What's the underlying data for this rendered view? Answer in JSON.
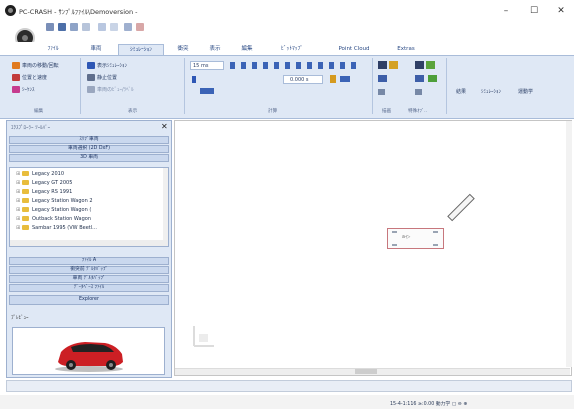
{
  "window": {
    "title": "PC-CRASH - ｻﾝﾌﾟﾙﾌｧｲﾙ\\Demoversion -",
    "minimize": "–",
    "maximize": "☐",
    "close": "✕"
  },
  "tabs": [
    "ﾌｧｲﾙ",
    "車両",
    "ｼﾐｭﾚｰｼｮﾝ",
    "衝突",
    "表示",
    "編集",
    "ﾋﾞｯﾄﾏｯﾌﾟ",
    "Point Cloud",
    "Extras"
  ],
  "ribbon": {
    "edit_group": {
      "move_rotate_label": "車両の移動/回転",
      "position_speed_label": "位置と速度",
      "sequence_label": "ｼｰｹﾝｽ",
      "group_label": "編集"
    },
    "display_group": {
      "simulation_display_label": "表示ｼﾐｭﾚｰｼｮﾝ",
      "rest_position_label": "静止位置",
      "vehicle_view_label": "車両のﾋﾞｭｰ/ﾗﾍﾞﾙ",
      "group_label": "表示"
    },
    "calc_group": {
      "step_value": "15 ms",
      "time_value": "0.000 s",
      "group_label": "計算"
    },
    "extra_labels": {
      "drawing_label": "描画",
      "special_label": "特殊ｵﾌﾞ..",
      "results_label": "結果",
      "simulation_label": "ｼﾐｭﾚｰｼｮﾝ",
      "kinematics_label": "運動学"
    }
  },
  "left_panel": {
    "header": "ｴｸｽﾌﾟﾛｰﾗｰ ﾂｰﾙﾊﾞｰ",
    "close": "✕",
    "bars_top": [
      "ｽﾘﾌﾞ車両",
      "車両選択 (2D DxF)",
      "3D 車両"
    ],
    "tree_items": [
      "Legacy 2010",
      "Legacy GT 2005",
      "Legacy RS 1991",
      "Legacy Station Wagon 2",
      "Legacy Station Wagon (",
      "Outback Station Wagon",
      "Sambar 1995 (VW Beetl..."
    ],
    "bars_bottom": [
      "ﾌｧｲﾙ A",
      "衝突前 ﾃﾞﾙﾀﾊﾞｯﾌﾟ",
      "車両 ﾃﾞﾙﾀﾊﾞｯﾌﾟ",
      "ﾃﾞｰﾀﾍﾞｰｽ ﾌｧｲﾙ",
      "Explorer"
    ],
    "preview_label": "ﾌﾟﾚﾋﾞｭｰ"
  },
  "canvas": {
    "vehicle_label": "a-▷"
  },
  "status": {
    "text": "15-4-1:116  ≥:0.00  動力学 ▢       ⊖       ⊕"
  },
  "colors": {
    "ribbon_bg": "#dfe8f5",
    "panel_border": "#9db0cf",
    "car_red": "#cc1f24",
    "vehicle_outline": "#c7777d"
  }
}
